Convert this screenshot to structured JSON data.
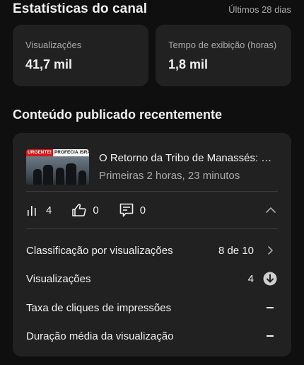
{
  "channel_stats": {
    "title": "Estatísticas do canal",
    "period": "Últimos 28 dias",
    "cards": [
      {
        "label": "Visualizações",
        "value": "41,7 mil"
      },
      {
        "label": "Tempo de exibição (horas)",
        "value": "1,8 mil"
      }
    ]
  },
  "recent": {
    "title": "Conteúdo publicado recentemente",
    "video": {
      "thumbnail_text": [
        "URGENTE!",
        "PROFECIA",
        "ISRAEL"
      ],
      "title": "O Retorno da Tribo de Manassés: Profecia",
      "subtitle": "Primeiras 2 horas, 23 minutos"
    },
    "metrics": [
      {
        "icon": "bar-chart-icon",
        "count": "4"
      },
      {
        "icon": "thumbs-up-icon",
        "count": "0"
      },
      {
        "icon": "comment-icon",
        "count": "0"
      }
    ],
    "details": [
      {
        "label": "Classificação por visualizações",
        "value": "8 de 10",
        "icon": "chevron-right-icon"
      },
      {
        "label": "Visualizações",
        "value": "4",
        "icon": "arrow-down-circle-icon"
      },
      {
        "label": "Taxa de cliques de impressões",
        "value": "",
        "icon": "dash-icon"
      },
      {
        "label": "Duração média da visualização",
        "value": "",
        "icon": "dash-icon"
      }
    ]
  },
  "colors": {
    "background": "#0f0f0f",
    "card": "#212121",
    "text_primary": "#f1f1f1",
    "text_secondary": "#aaaaaa",
    "urgent_red": "#d11a1a"
  }
}
